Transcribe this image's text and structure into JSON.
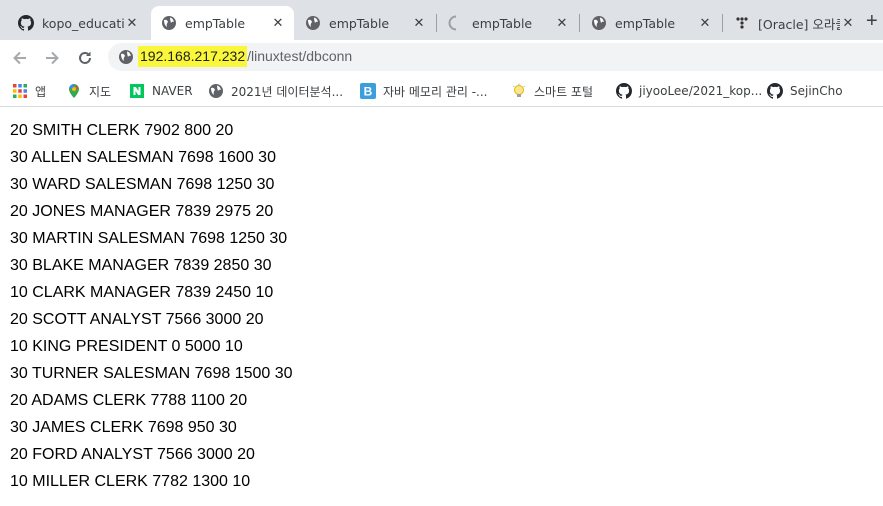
{
  "tabs": [
    {
      "title": "kopo_educatio",
      "icon": "github-icon",
      "active": false
    },
    {
      "title": "empTable",
      "icon": "globe-icon",
      "active": true
    },
    {
      "title": "empTable",
      "icon": "globe-icon",
      "active": false
    },
    {
      "title": "empTable",
      "icon": "loading-icon",
      "active": false
    },
    {
      "title": "empTable",
      "icon": "globe-icon",
      "active": false
    },
    {
      "title": "[Oracle] 오라클",
      "icon": "blog-icon",
      "active": false
    }
  ],
  "address": {
    "host": "192.168.217.232",
    "path": "/linuxtest/dbconn"
  },
  "bookmarks": [
    {
      "label": "앱",
      "icon": "apps-icon"
    },
    {
      "label": "지도",
      "icon": "maps-icon"
    },
    {
      "label": "NAVER",
      "icon": "naver-icon"
    },
    {
      "label": "2021년 데이터분석...",
      "icon": "globe-icon"
    },
    {
      "label": "자바 메모리 관리 -...",
      "icon": "blog-b-icon"
    },
    {
      "label": "스마트 포털",
      "icon": "bulb-icon"
    },
    {
      "label": "jiyooLee/2021_kop...",
      "icon": "github-icon"
    },
    {
      "label": "SejinCho",
      "icon": "github-icon"
    }
  ],
  "rows": [
    "20 SMITH CLERK 7902 800 20",
    "30 ALLEN SALESMAN 7698 1600 30",
    "30 WARD SALESMAN 7698 1250 30",
    "20 JONES MANAGER 7839 2975 20",
    "30 MARTIN SALESMAN 7698 1250 30",
    "30 BLAKE MANAGER 7839 2850 30",
    "10 CLARK MANAGER 7839 2450 10",
    "20 SCOTT ANALYST 7566 3000 20",
    "10 KING PRESIDENT 0 5000 10",
    "30 TURNER SALESMAN 7698 1500 30",
    "20 ADAMS CLERK 7788 1100 20",
    "30 JAMES CLERK 7698 950 30",
    "20 FORD ANALYST 7566 3000 20",
    "10 MILLER CLERK 7782 1300 10"
  ],
  "colors": {
    "highlight": "#faf73a",
    "tabstrip": "#dee1e6",
    "omnibox": "#f1f3f4"
  }
}
